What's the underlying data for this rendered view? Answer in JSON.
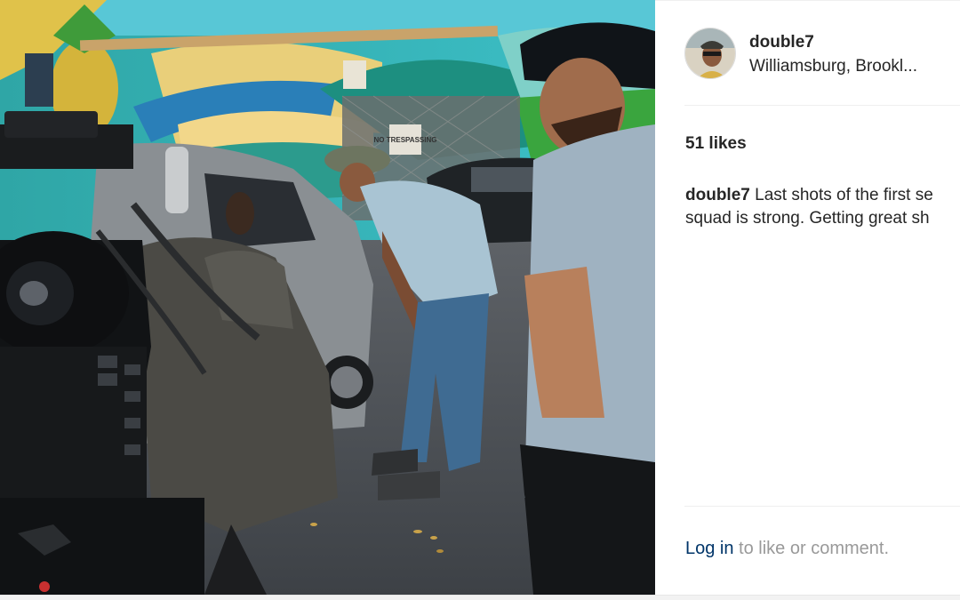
{
  "post": {
    "username": "double7",
    "location": "Williamsburg, Brookl...",
    "likes": "51 likes",
    "caption_user": "double7",
    "caption_line1": "Last shots of the first se",
    "caption_line2": "squad is strong. Getting great sh",
    "login_link": "Log in",
    "login_suffix": " to like or comment."
  },
  "photo": {
    "sign_text": "NO TRESPASSING",
    "subject": "film-crew-street-scene"
  },
  "colors": {
    "text": "#262626",
    "muted": "#999999",
    "link": "#003569",
    "divider": "#efefef"
  }
}
